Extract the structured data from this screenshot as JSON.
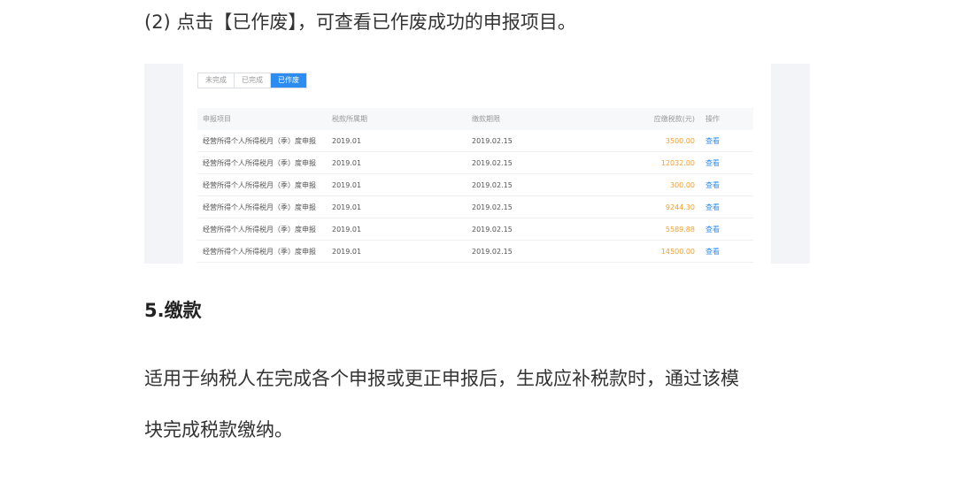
{
  "article": {
    "step_text": "(2) 点击【已作废】，可查看已作废成功的申报项目。",
    "section_heading": "5.缴款",
    "description_line1": "适用于纳税人在完成各个申报或更正申报后，生成应补税款时，通过该模",
    "description_line2": "块完成税款缴纳。"
  },
  "screenshot": {
    "tabs": [
      {
        "label": "未完成",
        "active": false
      },
      {
        "label": "已完成",
        "active": false
      },
      {
        "label": "已作废",
        "active": true
      }
    ],
    "table": {
      "headers": [
        "申报项目",
        "税款所属期",
        "缴款期限",
        "应缴税款(元)",
        "操作"
      ],
      "rows": [
        {
          "item": "经营所得个人所得税月（季）度申报",
          "period": "2019.01",
          "deadline": "2019.02.15",
          "amount": "3500.00",
          "action": "查看"
        },
        {
          "item": "经营所得个人所得税月（季）度申报",
          "period": "2019.01",
          "deadline": "2019.02.15",
          "amount": "12032.00",
          "action": "查看"
        },
        {
          "item": "经营所得个人所得税月（季）度申报",
          "period": "2019.01",
          "deadline": "2019.02.15",
          "amount": "300.00",
          "action": "查看"
        },
        {
          "item": "经营所得个人所得税月（季）度申报",
          "period": "2019.01",
          "deadline": "2019.02.15",
          "amount": "9244.30",
          "action": "查看"
        },
        {
          "item": "经营所得个人所得税月（季）度申报",
          "period": "2019.01",
          "deadline": "2019.02.15",
          "amount": "5589.88",
          "action": "查看"
        },
        {
          "item": "经营所得个人所得税月（季）度申报",
          "period": "2019.01",
          "deadline": "2019.02.15",
          "amount": "14500.00",
          "action": "查看"
        }
      ]
    }
  },
  "colors": {
    "accent": "#2d8cf0",
    "amount": "#f0a030",
    "figure_background": "#f2f4f8"
  }
}
